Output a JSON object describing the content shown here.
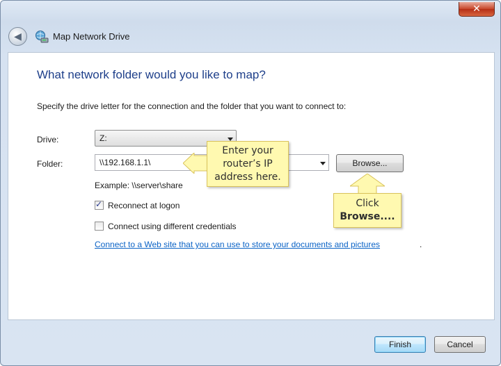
{
  "window": {
    "title": "Map Network Drive",
    "close_label": "✕",
    "back_label": "◀"
  },
  "main": {
    "heading": "What network folder would you like to map?",
    "instruction": "Specify the drive letter for the connection and the folder that you want to connect to:",
    "drive_label": "Drive:",
    "drive_value": "Z:",
    "folder_label": "Folder:",
    "folder_value": "\\\\192.168.1.1\\",
    "browse_label": "Browse...",
    "example": "Example: \\\\server\\share",
    "reconnect_label": "Reconnect at logon",
    "reconnect_checked": true,
    "credentials_label": "Connect using different credentials",
    "credentials_checked": false,
    "link_text": "Connect to a Web site that you can use to store your documents and pictures",
    "link_suffix": "."
  },
  "callouts": {
    "ip": {
      "line1": "Enter your",
      "line2": "router’s IP",
      "line3": "address here."
    },
    "browse": {
      "line1": "Click",
      "line2": "Browse...."
    }
  },
  "footer": {
    "finish_label": "Finish",
    "cancel_label": "Cancel"
  },
  "colors": {
    "heading": "#1e3f8a",
    "link": "#0b63c6",
    "callout_bg": "#fff9b0"
  }
}
